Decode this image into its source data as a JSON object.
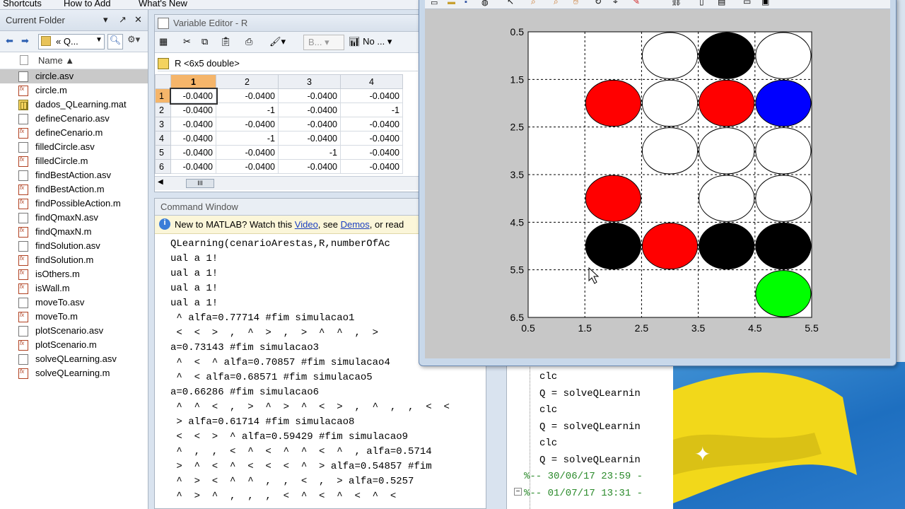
{
  "shortcuts": {
    "items": [
      "Shortcuts",
      "How to Add",
      "What's New"
    ]
  },
  "folder": {
    "title": "Current Folder",
    "path": "« Q...",
    "column_header": "Name ▲",
    "files": [
      {
        "name": "circle.asv",
        "type": "asv",
        "selected": true
      },
      {
        "name": "circle.m",
        "type": "m"
      },
      {
        "name": "dados_QLearning.mat",
        "type": "mat"
      },
      {
        "name": "defineCenario.asv",
        "type": "asv"
      },
      {
        "name": "defineCenario.m",
        "type": "m"
      },
      {
        "name": "filledCircle.asv",
        "type": "asv"
      },
      {
        "name": "filledCircle.m",
        "type": "m"
      },
      {
        "name": "findBestAction.asv",
        "type": "asv"
      },
      {
        "name": "findBestAction.m",
        "type": "m"
      },
      {
        "name": "findPossibleAction.m",
        "type": "m"
      },
      {
        "name": "findQmaxN.asv",
        "type": "asv"
      },
      {
        "name": "findQmaxN.m",
        "type": "m"
      },
      {
        "name": "findSolution.asv",
        "type": "asv"
      },
      {
        "name": "findSolution.m",
        "type": "m"
      },
      {
        "name": "isOthers.m",
        "type": "m"
      },
      {
        "name": "isWall.m",
        "type": "m"
      },
      {
        "name": "moveTo.asv",
        "type": "asv"
      },
      {
        "name": "moveTo.m",
        "type": "m"
      },
      {
        "name": "plotScenario.asv",
        "type": "asv"
      },
      {
        "name": "plotScenario.m",
        "type": "m"
      },
      {
        "name": "solveQLearning.asv",
        "type": "asv"
      },
      {
        "name": "solveQLearning.m",
        "type": "m"
      }
    ]
  },
  "var_editor": {
    "title": "Variable Editor - R",
    "var_label": "R <6x5 double>",
    "toolbar_select": "B...",
    "toolbar_no": "No ...",
    "columns": [
      "1",
      "2",
      "3",
      "4"
    ],
    "rows": [
      {
        "idx": "1",
        "cells": [
          "-0.0400",
          "-0.0400",
          "-0.0400",
          "-0.0400"
        ]
      },
      {
        "idx": "2",
        "cells": [
          "-0.0400",
          "-1",
          "-0.0400",
          "-1"
        ]
      },
      {
        "idx": "3",
        "cells": [
          "-0.0400",
          "-0.0400",
          "-0.0400",
          "-0.0400"
        ]
      },
      {
        "idx": "4",
        "cells": [
          "-0.0400",
          "-1",
          "-0.0400",
          "-0.0400"
        ]
      },
      {
        "idx": "5",
        "cells": [
          "-0.0400",
          "-0.0400",
          "-1",
          "-0.0400"
        ]
      },
      {
        "idx": "6",
        "cells": [
          "-0.0400",
          "-0.0400",
          "-0.0400",
          "-0.0400"
        ]
      }
    ],
    "scroll_thumb": "III"
  },
  "command_window": {
    "title": "Command Window",
    "info_prefix": "New to MATLAB? Watch this ",
    "info_video": "Video",
    "info_mid": ", see ",
    "info_demos": "Demos",
    "info_suffix": ", or read",
    "lines": [
      "QLearning(cenarioArestas,R,numberOfAc",
      "ual a 1!",
      "ual a 1!",
      "ual a 1!",
      "ual a 1!",
      " ^ alfa=0.77714 #fim simulacao1",
      " <  <  >  ,  ^  >  ,  >  ^  ^  ,  >",
      "a=0.73143 #fim simulacao3",
      " ^  <  ^ alfa=0.70857 #fim simulacao4",
      " ^  < alfa=0.68571 #fim simulacao5",
      "a=0.66286 #fim simulacao6",
      " ^  ^  <  ,  >  ^  >  ^  <  >  ,  ^  ,  ,  <  <",
      " > alfa=0.61714 #fim simulacao8",
      " <  <  >  ^ alfa=0.59429 #fim simulacao9",
      " ^  ,  ,  <  ^  <  ^  ^  <  ^  , alfa=0.5714",
      " >  ^  <  ^  <  <  <  ^  > alfa=0.54857 #fim",
      " ^  >  <  ^  ^  ,  ,  <  ,  > alfa=0.5257",
      " ^  >  ^  ,  ,  ,  <  ^  <  ^  <  ^  <"
    ]
  },
  "history": {
    "lines": [
      {
        "text": "clc",
        "kind": "cmd"
      },
      {
        "text": "Q = solveQLearnin",
        "kind": "cmd"
      },
      {
        "text": "clc",
        "kind": "cmd"
      },
      {
        "text": "Q = solveQLearnin",
        "kind": "cmd"
      },
      {
        "text": "clc",
        "kind": "cmd"
      },
      {
        "text": "Q = solveQLearnin",
        "kind": "cmd"
      },
      {
        "text": "%-- 30/06/17 23:59 -",
        "kind": "date"
      },
      {
        "text": "%-- 01/07/17 13:31 -",
        "kind": "date"
      }
    ]
  },
  "figure": {
    "x_ticks": [
      "0.5",
      "1.5",
      "2.5",
      "3.5",
      "4.5",
      "5.5"
    ],
    "y_ticks": [
      "0.5",
      "1.5",
      "2.5",
      "3.5",
      "4.5",
      "5.5",
      "6.5"
    ],
    "colors": {
      "black": "#000000",
      "white": "#ffffff",
      "red": "#ff0000",
      "blue": "#0000ff",
      "green": "#00ff00"
    }
  },
  "chart_data": {
    "type": "scatter",
    "xlim": [
      0.5,
      5.5
    ],
    "ylim": [
      0.5,
      6.5
    ],
    "y_reversed": true,
    "grid": true,
    "points": [
      {
        "x": 3,
        "y": 1,
        "color": "white"
      },
      {
        "x": 4,
        "y": 1,
        "color": "black"
      },
      {
        "x": 5,
        "y": 1,
        "color": "white"
      },
      {
        "x": 2,
        "y": 2,
        "color": "red"
      },
      {
        "x": 3,
        "y": 2,
        "color": "white"
      },
      {
        "x": 4,
        "y": 2,
        "color": "red"
      },
      {
        "x": 5,
        "y": 2,
        "color": "blue"
      },
      {
        "x": 3,
        "y": 3,
        "color": "white"
      },
      {
        "x": 4,
        "y": 3,
        "color": "white"
      },
      {
        "x": 5,
        "y": 3,
        "color": "white"
      },
      {
        "x": 2,
        "y": 4,
        "color": "red"
      },
      {
        "x": 4,
        "y": 4,
        "color": "white"
      },
      {
        "x": 5,
        "y": 4,
        "color": "white"
      },
      {
        "x": 2,
        "y": 5,
        "color": "black"
      },
      {
        "x": 3,
        "y": 5,
        "color": "red"
      },
      {
        "x": 4,
        "y": 5,
        "color": "black"
      },
      {
        "x": 5,
        "y": 5,
        "color": "black"
      },
      {
        "x": 5,
        "y": 6,
        "color": "green"
      }
    ]
  }
}
